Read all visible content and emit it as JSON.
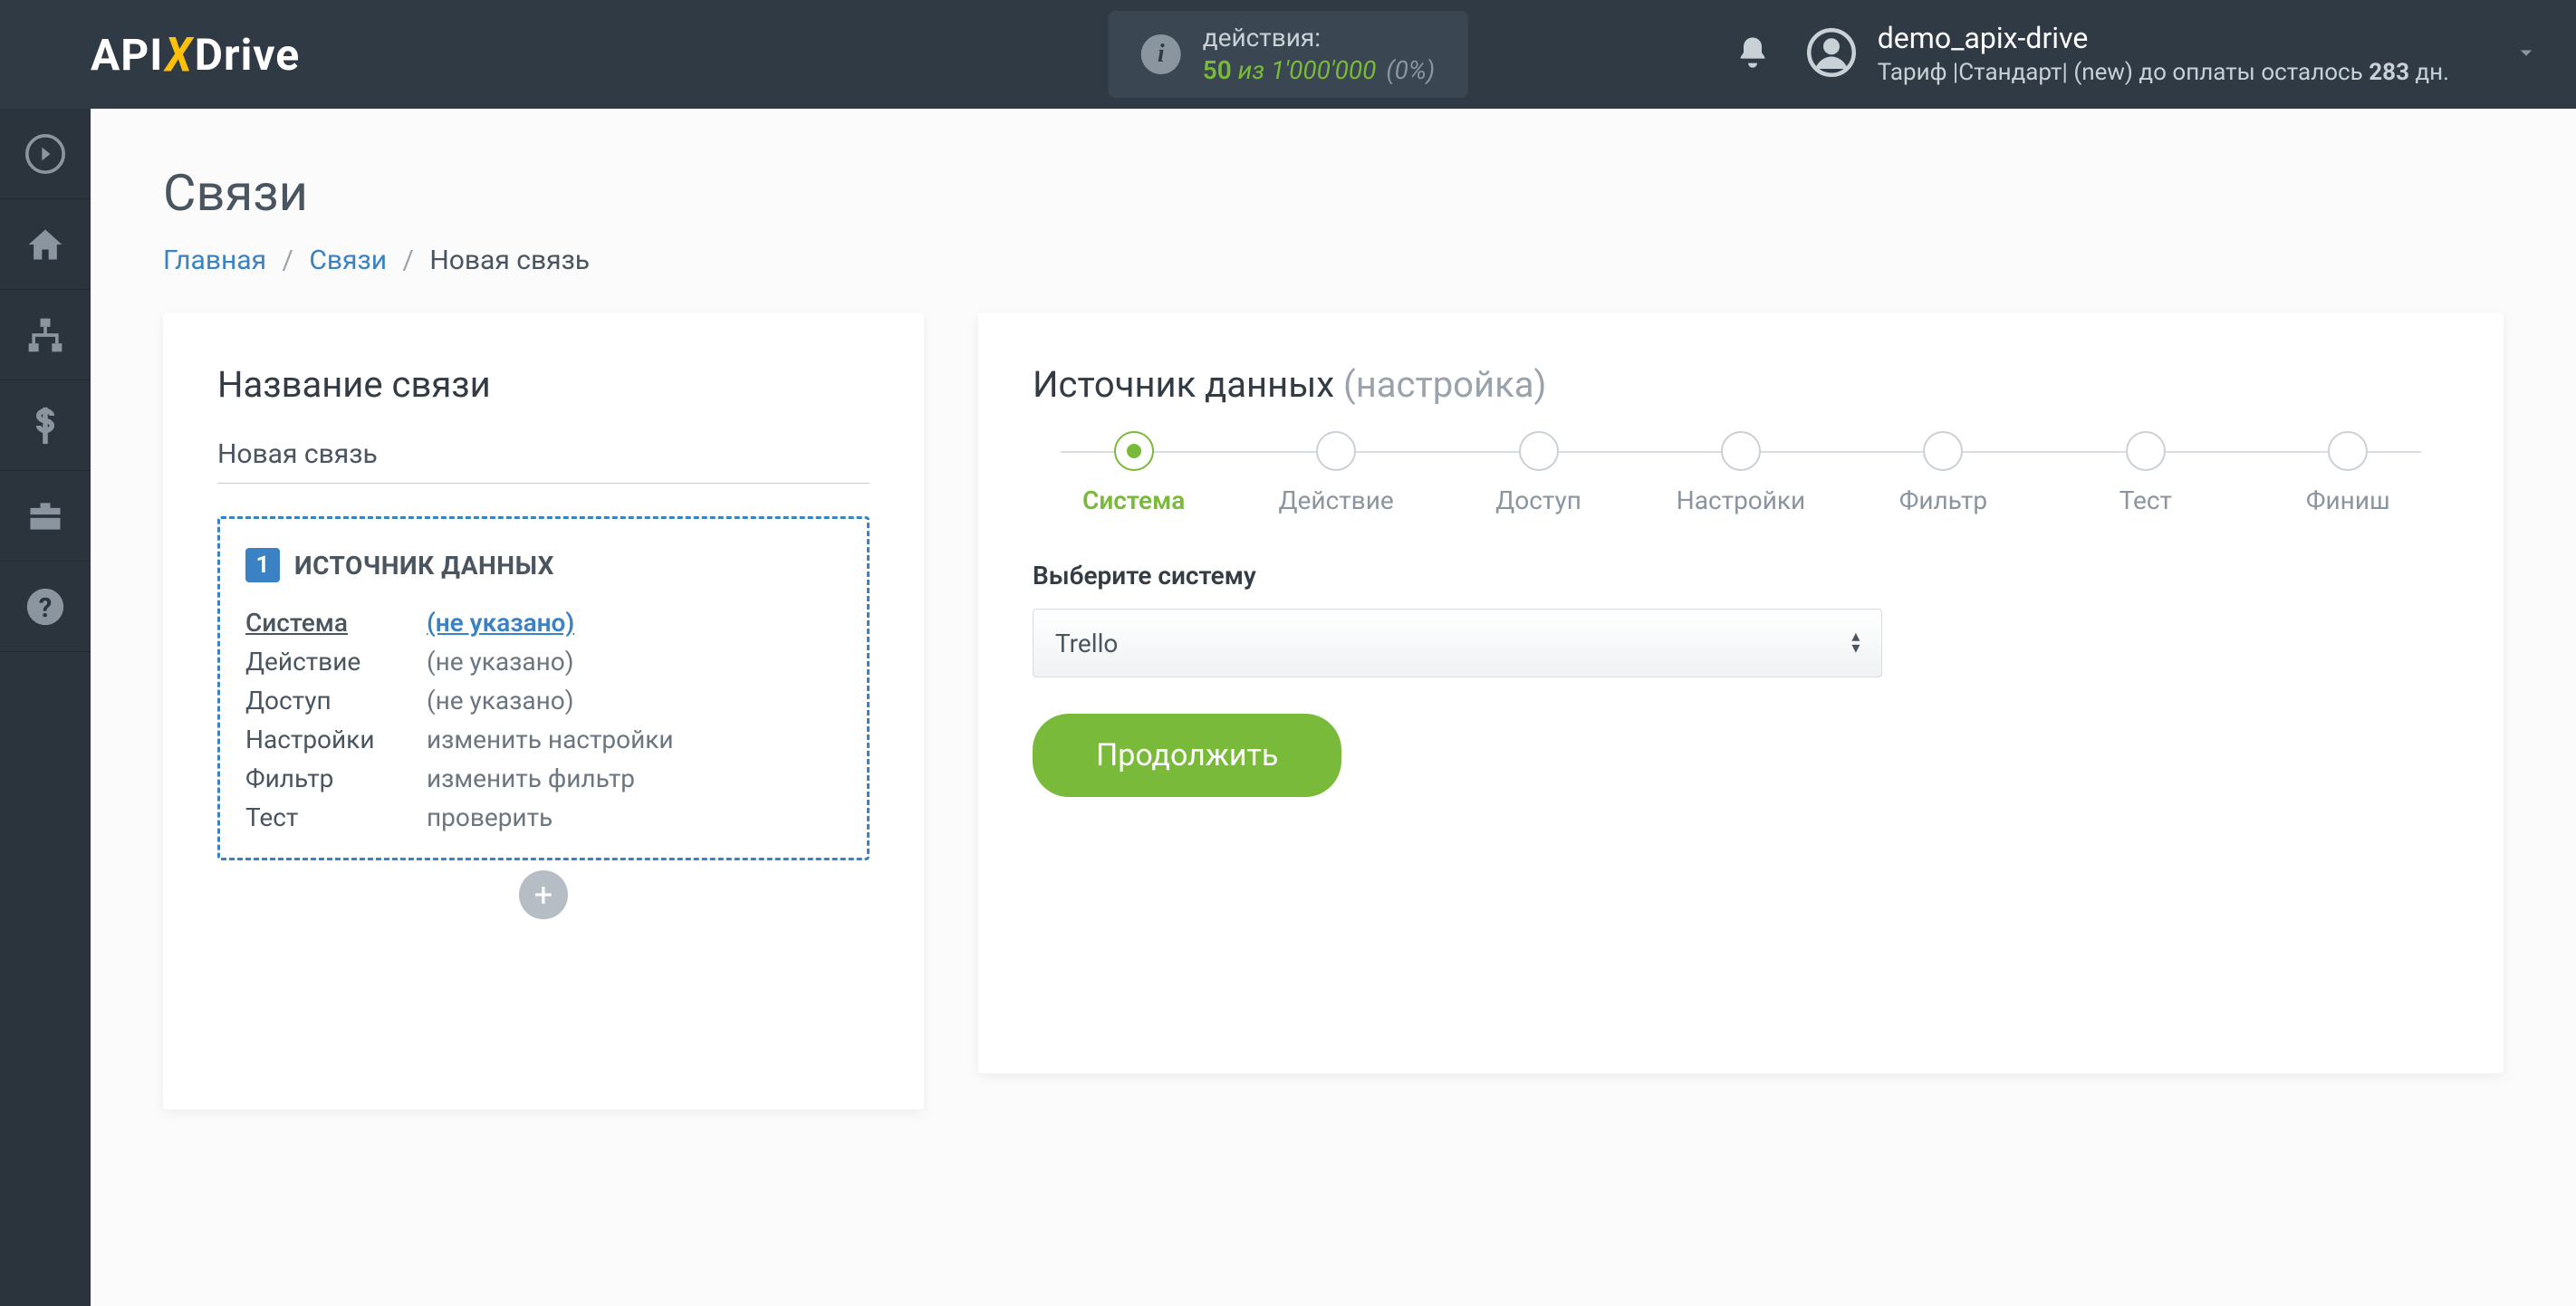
{
  "header": {
    "logo": {
      "api": "API",
      "x": "X",
      "drive": "Drive"
    },
    "actions": {
      "label": "действия:",
      "used": "50",
      "of_word": "из",
      "total": "1'000'000",
      "percent": "(0%)"
    },
    "user": {
      "name": "demo_apix-drive",
      "plan_prefix": "Тариф |Стандарт| (new) до оплаты осталось ",
      "plan_days": "283",
      "plan_suffix": " дн."
    }
  },
  "sidebar": [
    "arrow",
    "home",
    "sitemap",
    "dollar",
    "briefcase",
    "help"
  ],
  "page": {
    "title": "Связи",
    "breadcrumb": {
      "home": "Главная",
      "links": "Связи",
      "current": "Новая связь"
    }
  },
  "left_card": {
    "heading": "Название связи",
    "name_value": "Новая связь",
    "source_block_title": "ИСТОЧНИК ДАННЫХ",
    "badge": "1",
    "rows": [
      {
        "label": "Система",
        "value": "(не указано)",
        "active": true
      },
      {
        "label": "Действие",
        "value": "(не указано)"
      },
      {
        "label": "Доступ",
        "value": "(не указано)"
      },
      {
        "label": "Настройки",
        "value": "изменить настройки"
      },
      {
        "label": "Фильтр",
        "value": "изменить фильтр"
      },
      {
        "label": "Тест",
        "value": "проверить"
      }
    ],
    "add_label": "+"
  },
  "right_card": {
    "heading_main": "Источник данных ",
    "heading_sub": "(настройка)",
    "steps": [
      {
        "label": "Система",
        "active": true
      },
      {
        "label": "Действие"
      },
      {
        "label": "Доступ"
      },
      {
        "label": "Настройки"
      },
      {
        "label": "Фильтр"
      },
      {
        "label": "Тест"
      },
      {
        "label": "Финиш"
      }
    ],
    "select_label": "Выберите систему",
    "select_value": "Trello",
    "continue": "Продолжить"
  }
}
